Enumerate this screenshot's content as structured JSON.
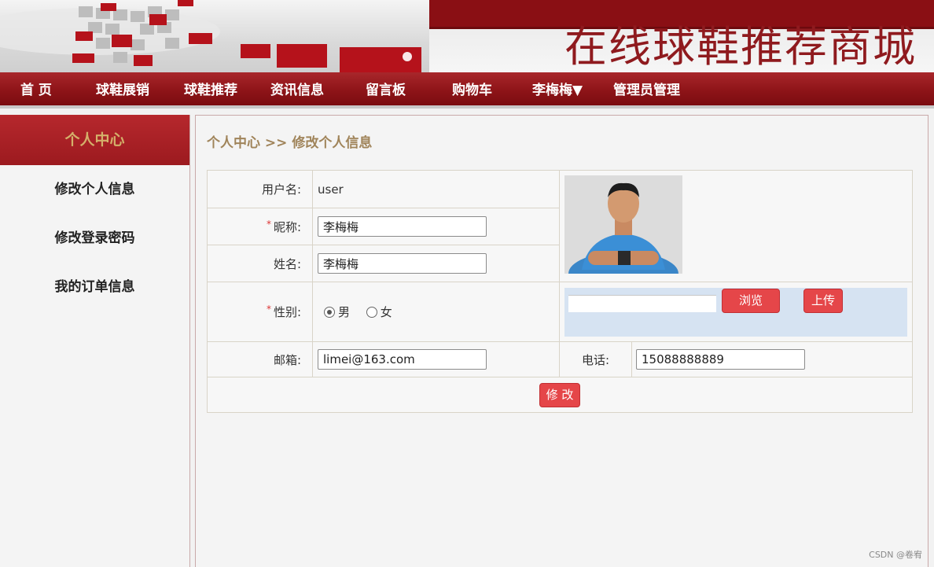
{
  "site": {
    "title": "在线球鞋推荐商城"
  },
  "nav": {
    "items": [
      {
        "label": "首 页",
        "name": "nav-home"
      },
      {
        "label": "球鞋展销",
        "name": "nav-shoe-sales"
      },
      {
        "label": "球鞋推荐",
        "name": "nav-shoe-recommend"
      },
      {
        "label": "资讯信息",
        "name": "nav-news"
      },
      {
        "label": "留言板",
        "name": "nav-message-board"
      },
      {
        "label": "购物车",
        "name": "nav-cart"
      },
      {
        "label": "李梅梅▼",
        "name": "nav-user-menu"
      },
      {
        "label": "管理员管理",
        "name": "nav-admin"
      }
    ]
  },
  "sidebar": {
    "heading": "个人中心",
    "items": [
      {
        "label": "修改个人信息"
      },
      {
        "label": "修改登录密码"
      },
      {
        "label": "我的订单信息"
      }
    ]
  },
  "main": {
    "breadcrumb": "个人中心 >> 修改个人信息",
    "form": {
      "username_label": "用户名:",
      "username_value": "user",
      "nickname_label": "昵称:",
      "nickname_value": "李梅梅",
      "realname_label": "姓名:",
      "realname_value": "李梅梅",
      "gender_label": "性别:",
      "gender_options": [
        "男",
        "女"
      ],
      "gender_selected": "男",
      "email_label": "邮箱:",
      "email_value": "limei@163.com",
      "phone_label": "电话:",
      "phone_value": "15088888889",
      "required_mark": "*",
      "browse_label": "浏览",
      "upload_label": "上传",
      "submit_label": "修 改"
    }
  },
  "watermark": "CSDN @卷宥",
  "colors": {
    "brand_red": "#8e1418",
    "button_red": "#e54649",
    "accent_gold": "#d4b06a",
    "upload_bg": "#d6e3f2"
  }
}
